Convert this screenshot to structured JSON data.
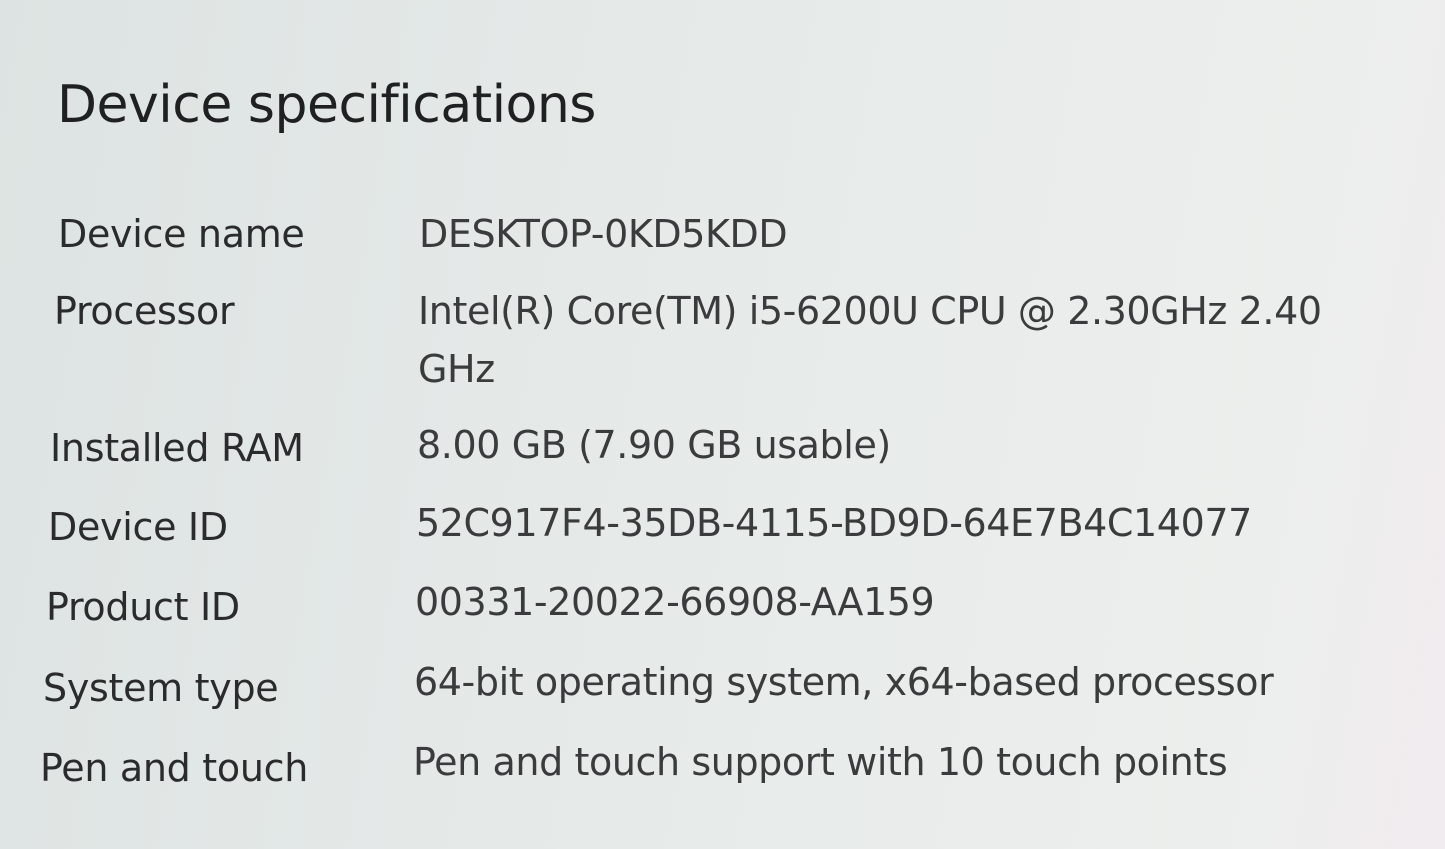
{
  "header": {
    "title": "Device specifications"
  },
  "specs": [
    {
      "label": "Device name",
      "value": "DESKTOP-0KD5KDD"
    },
    {
      "label": "Processor",
      "value": "Intel(R) Core(TM) i5-6200U CPU @ 2.30GHz   2.40 GHz"
    },
    {
      "label": "Installed RAM",
      "value": "8.00 GB (7.90 GB usable)"
    },
    {
      "label": "Device ID",
      "value": "52C917F4-35DB-4115-BD9D-64E7B4C14077"
    },
    {
      "label": "Product ID",
      "value": "00331-20022-66908-AA159"
    },
    {
      "label": "System type",
      "value": "64-bit operating system, x64-based processor"
    },
    {
      "label": "Pen and touch",
      "value": "Pen and touch support with 10 touch points"
    }
  ]
}
